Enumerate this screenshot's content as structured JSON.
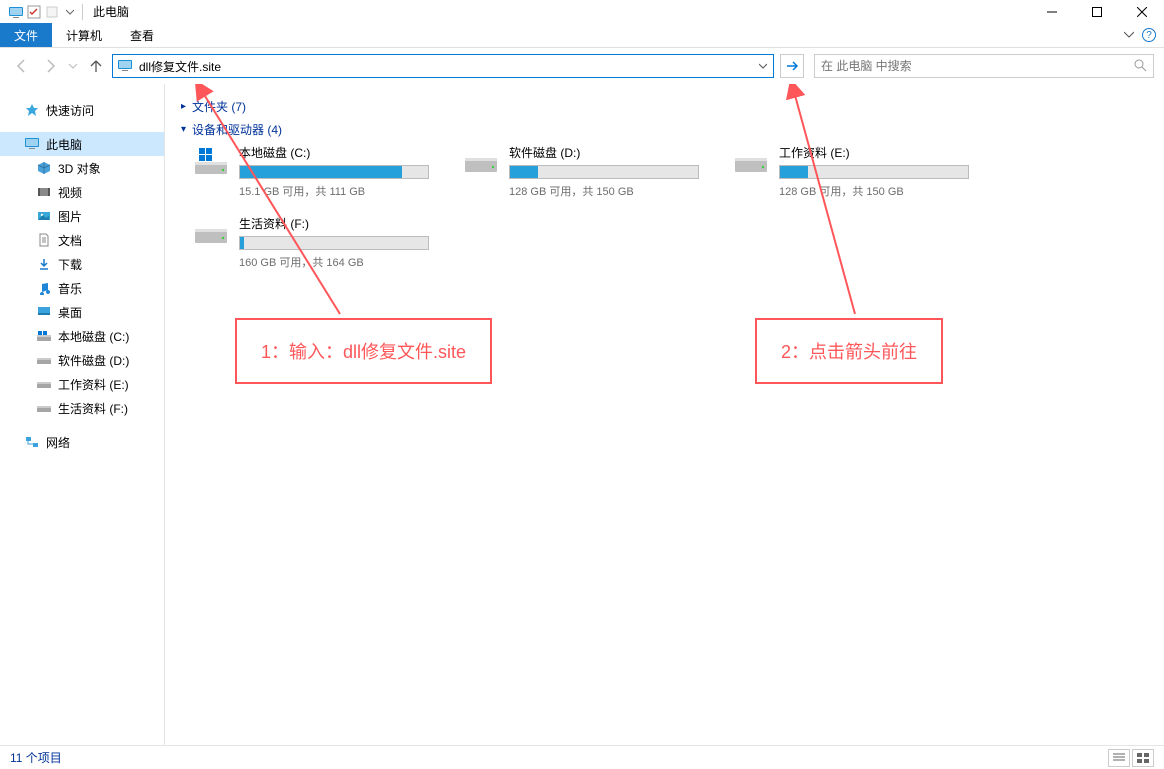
{
  "title": "此电脑",
  "menu": {
    "file": "文件",
    "computer": "计算机",
    "view": "查看"
  },
  "address": {
    "value": "dll修复文件.site"
  },
  "search": {
    "placeholder": "在 此电脑 中搜索"
  },
  "sidebar": {
    "quick": "快速访问",
    "thispc": "此电脑",
    "objects3d": "3D 对象",
    "video": "视频",
    "pictures": "图片",
    "docs": "文档",
    "downloads": "下载",
    "music": "音乐",
    "desktop": "桌面",
    "local_c": "本地磁盘 (C:)",
    "soft_d": "软件磁盘 (D:)",
    "work_e": "工作资料 (E:)",
    "life_f": "生活资料 (F:)",
    "network": "网络"
  },
  "groups": {
    "folders": "文件夹 (7)",
    "drives": "设备和驱动器 (4)"
  },
  "drives": [
    {
      "name": "本地磁盘 (C:)",
      "info": "15.1 GB 可用，共 111 GB",
      "fill": 86,
      "os": true
    },
    {
      "name": "软件磁盘 (D:)",
      "info": "128 GB 可用，共 150 GB",
      "fill": 15,
      "os": false
    },
    {
      "name": "工作资料 (E:)",
      "info": "128 GB 可用，共 150 GB",
      "fill": 15,
      "os": false
    },
    {
      "name": "生活资料 (F:)",
      "info": "160 GB 可用，共 164 GB",
      "fill": 2,
      "os": false
    }
  ],
  "callouts": {
    "c1": "1：输入：dll修复文件.site",
    "c2": "2：点击箭头前往"
  },
  "status": {
    "items": "11 个项目"
  }
}
